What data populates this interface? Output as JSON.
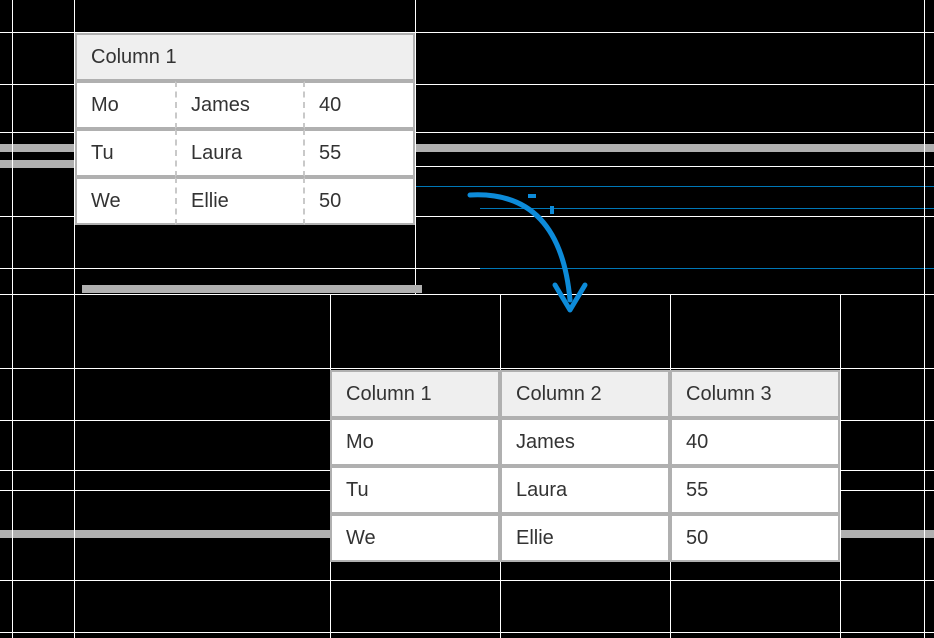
{
  "table1": {
    "header": "Column 1",
    "rows": [
      {
        "day": "Mo",
        "name": "James",
        "value": "40"
      },
      {
        "day": "Tu",
        "name": "Laura",
        "value": "55"
      },
      {
        "day": "We",
        "name": "Ellie",
        "value": "50"
      }
    ]
  },
  "table2": {
    "headers": [
      "Column 1",
      "Column 2",
      "Column 3"
    ],
    "rows": [
      {
        "c1": "Mo",
        "c2": "James",
        "c3": "40"
      },
      {
        "c1": "Tu",
        "c2": "Laura",
        "c3": "55"
      },
      {
        "c1": "We",
        "c2": "Ellie",
        "c3": "50"
      }
    ]
  },
  "colors": {
    "blue": "#0d8bd9",
    "grey": "#b0b0b0"
  }
}
